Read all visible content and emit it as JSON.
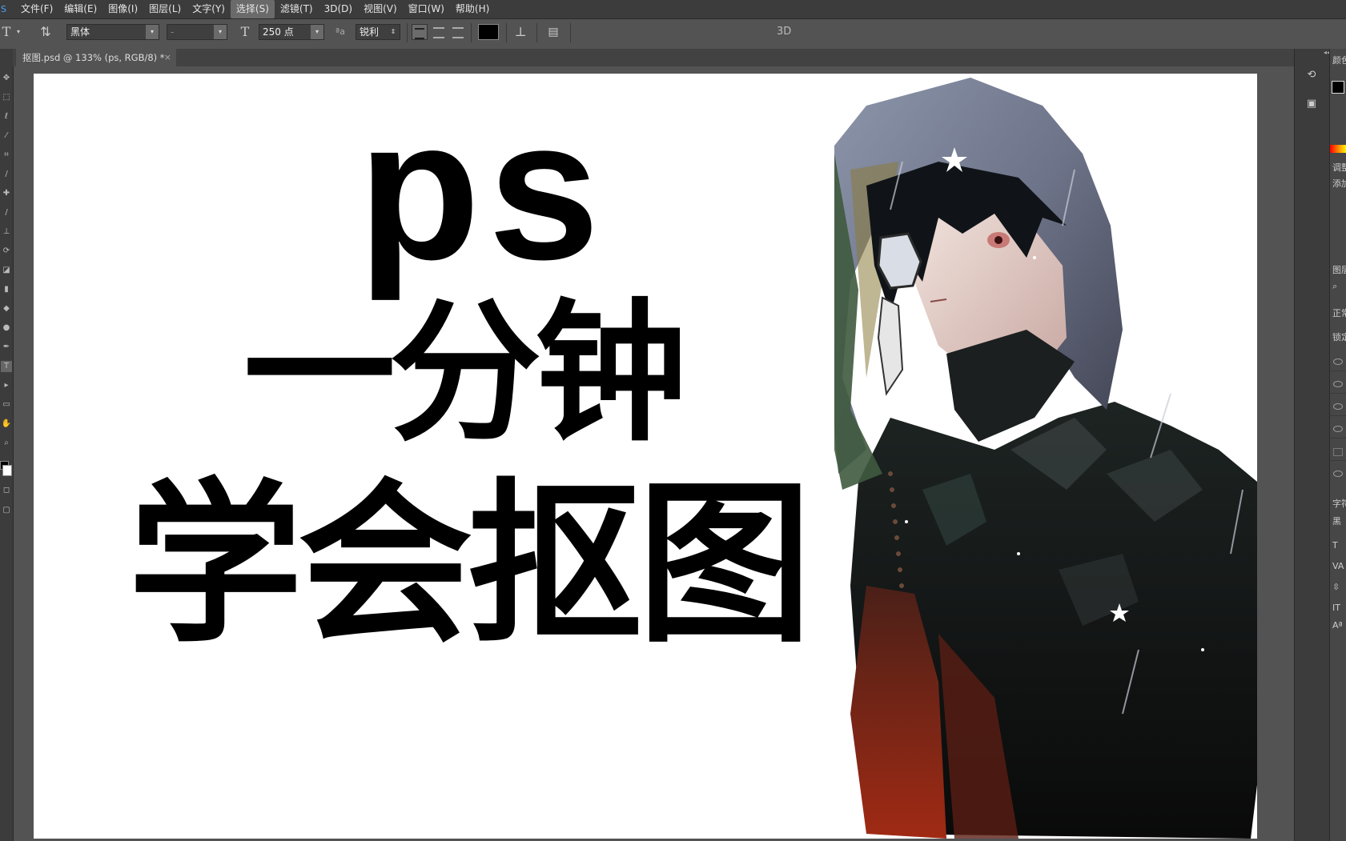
{
  "app": {
    "logo_text": "S"
  },
  "menu": [
    {
      "label": "文件(F)"
    },
    {
      "label": "编辑(E)"
    },
    {
      "label": "图像(I)"
    },
    {
      "label": "图层(L)"
    },
    {
      "label": "文字(Y)"
    },
    {
      "label": "选择(S)",
      "active": true
    },
    {
      "label": "滤镜(T)"
    },
    {
      "label": "3D(D)"
    },
    {
      "label": "视图(V)"
    },
    {
      "label": "窗口(W)"
    },
    {
      "label": "帮助(H)"
    }
  ],
  "options": {
    "tool_glyph": "T",
    "font_family": "黑体",
    "font_style": "-",
    "font_size": "250 点",
    "aa_label": "ªa",
    "anti_alias": "锐利",
    "mode_3d": "3D",
    "text_color": "#000000"
  },
  "document": {
    "tab_title": "抠图.psd @ 133% (ps, RGB/8) *",
    "close_glyph": "×"
  },
  "canvas_text": {
    "line1": "ps",
    "line2": "一分钟",
    "line3": "学会抠图"
  },
  "right_panel": {
    "color_label": "颜色",
    "adjust_label": "调整",
    "add_label": "添加",
    "layers_label": "图层",
    "normal_label": "正常",
    "lock_label": "锁定",
    "char_label": "字符",
    "font_short": "黑"
  },
  "colors": {
    "accent": "#4ea3ff",
    "canvas_bg": "#ffffff",
    "ui_bg": "#535353"
  }
}
